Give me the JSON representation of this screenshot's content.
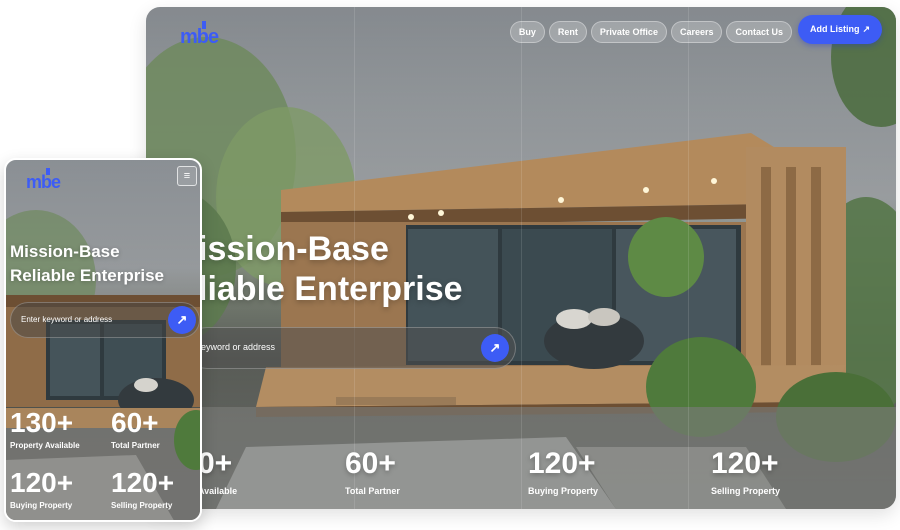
{
  "brand": {
    "logo_text": "mbe",
    "logo_color": "#3d5cf5"
  },
  "nav": {
    "items": [
      {
        "label": "Buy"
      },
      {
        "label": "Rent"
      },
      {
        "label": "Private Office"
      },
      {
        "label": "Careers"
      },
      {
        "label": "Contact Us"
      }
    ],
    "cta_label": "Add Listing",
    "cta_arrow": "↗"
  },
  "hero": {
    "title_line1": "Mission-Base",
    "title_line2": "Reliable Enterprise",
    "desktop_title_line1": "ission-Base",
    "desktop_title_line2": "liable Enterprise",
    "search_placeholder": "Enter keyword or address",
    "desktop_search_placeholder": "eyword or address",
    "search_arrow": "↗"
  },
  "stats": [
    {
      "value": "130+",
      "label": "Property Available"
    },
    {
      "value": "60+",
      "label": "Total Partner"
    },
    {
      "value": "120+",
      "label": "Buying Property"
    },
    {
      "value": "120+",
      "label": "Selling Property"
    }
  ],
  "desktop_stats_visible": [
    {
      "value": "0+",
      "label": "Available"
    },
    {
      "value": "60+",
      "label": "Total Partner"
    },
    {
      "value": "120+",
      "label": "Buying Property"
    },
    {
      "value": "120+",
      "label": "Selling Property"
    }
  ],
  "mobile_menu_icon": "≡",
  "colors": {
    "accent": "#3d5cf5",
    "text": "#ffffff"
  }
}
